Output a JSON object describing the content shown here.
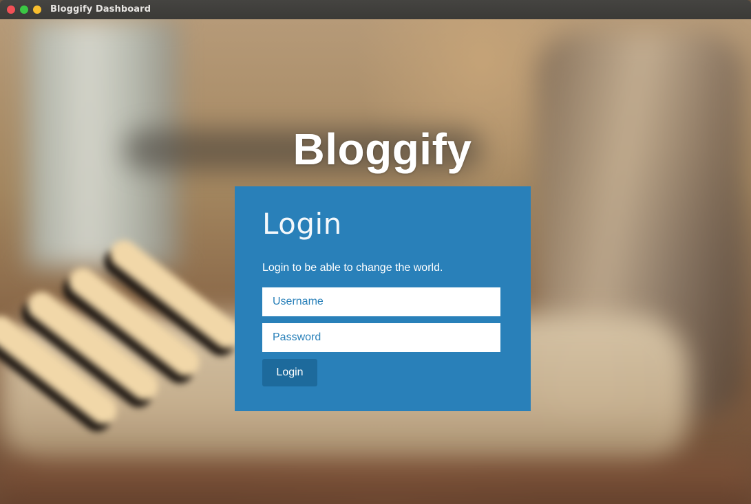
{
  "window": {
    "title": "Bloggify Dashboard",
    "controls": {
      "close_icon": "close-dot-icon",
      "minimize_icon": "minimize-dot-icon",
      "maximize_icon": "maximize-dot-icon"
    }
  },
  "brand": {
    "name": "Bloggify"
  },
  "login": {
    "heading": "Login",
    "subtitle": "Login to be able to change the world.",
    "username_placeholder": "Username",
    "username_value": "",
    "password_placeholder": "Password",
    "password_value": "",
    "submit_label": "Login"
  },
  "colors": {
    "panel": "#2980b9",
    "button": "#1d6a9c",
    "input_text": "#2980b9",
    "titlebar": "#3f3e3b"
  }
}
